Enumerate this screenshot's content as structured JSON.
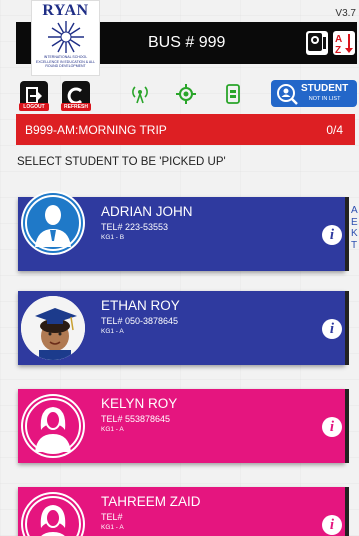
{
  "app": {
    "version": "V3.7",
    "logo_text": "RYAN",
    "logo_subtext": "INTERNATIONAL SCHOOL",
    "logo_tagline": "EXCELLENCE IN EDUCATION & ALL ROUND DEVELOPMENT"
  },
  "header": {
    "title": "BUS # 999"
  },
  "toolbar": {
    "logout_label": "LOGOUT",
    "refresh_label": "REFRESH",
    "student_button_label": "STUDENT",
    "student_button_sublabel": "NOT IN LIST"
  },
  "trip": {
    "name": "B999-AM:MORNING TRIP",
    "count": "0/4"
  },
  "section_title": "SELECT STUDENT TO BE 'PICKED UP'",
  "students": [
    {
      "name": "ADRIAN JOHN",
      "tel": "TEL# 223-53553",
      "grade": "KG1 - B",
      "color": "blue",
      "avatar": "male-student-icon"
    },
    {
      "name": "ETHAN ROY",
      "tel": "TEL# 050-3878645",
      "grade": "KG1 - A",
      "color": "blue",
      "avatar": "student-photo"
    },
    {
      "name": "KELYN ROY",
      "tel": "TEL# 553878645",
      "grade": "KG1 - A",
      "color": "pink",
      "avatar": "female-student-icon"
    },
    {
      "name": "TAHREEM ZAID",
      "tel": "TEL#",
      "grade": "KG1 - A",
      "color": "pink",
      "avatar": "female-student-icon"
    }
  ],
  "side_index": [
    "A",
    "E",
    "K",
    "T"
  ],
  "colors": {
    "header_bg": "#0a0a0a",
    "trip_bar": "#dd1f23",
    "male_card": "#2f3a9f",
    "female_card": "#e5157f",
    "accent_green": "#2aa52a",
    "student_button": "#2367c9"
  }
}
